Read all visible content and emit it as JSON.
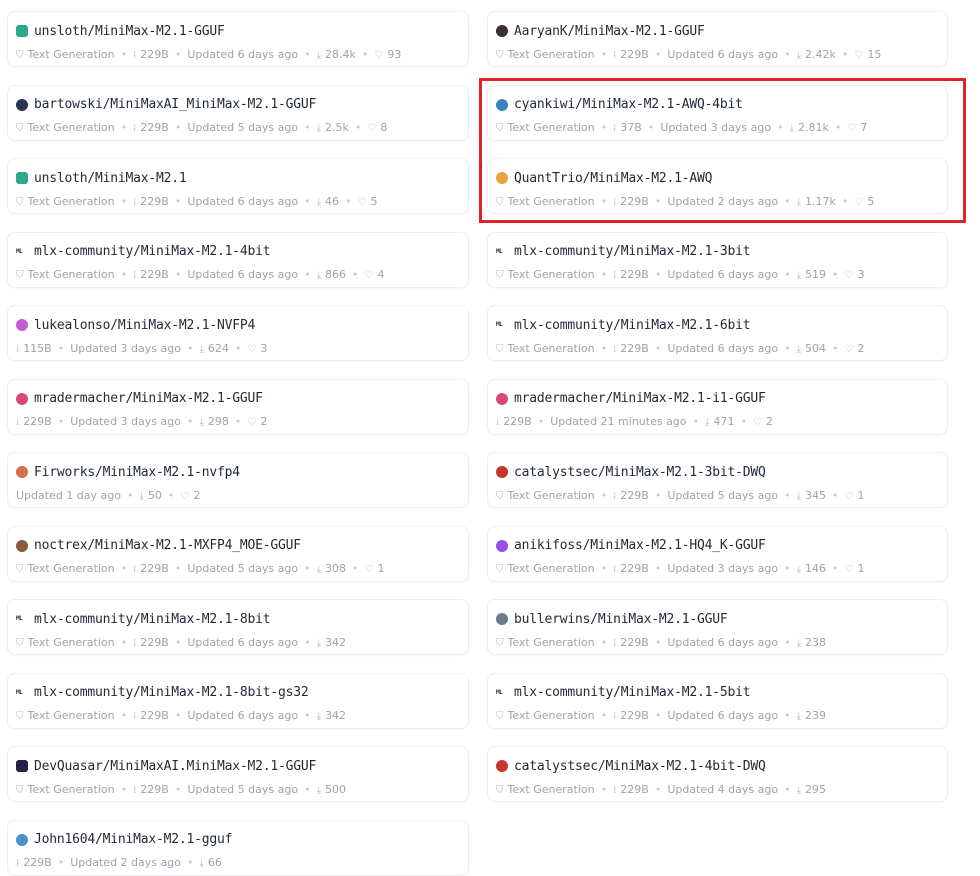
{
  "models": [
    {
      "avatar_color": "#2ea88a",
      "avatar_shape": "sq",
      "name": "unsloth/MiniMax-M2.1-GGUF",
      "task": "Text Generation",
      "size": "229B",
      "updated": "Updated 6 days ago",
      "downloads": "28.4k",
      "likes": "93"
    },
    {
      "avatar_color": "#3a2f2a",
      "avatar_shape": "circle",
      "name": "AaryanK/MiniMax-M2.1-GGUF",
      "task": "Text Generation",
      "size": "229B",
      "updated": "Updated 6 days ago",
      "downloads": "2.42k",
      "likes": "15"
    },
    {
      "avatar_color": "#2b3550",
      "avatar_shape": "circle",
      "name": "bartowski/MiniMaxAI_MiniMax-M2.1-GGUF",
      "task": "Text Generation",
      "size": "229B",
      "updated": "Updated 5 days ago",
      "downloads": "2.5k",
      "likes": "8"
    },
    {
      "avatar_color": "#3b82c4",
      "avatar_shape": "circle",
      "name": "cyankiwi/MiniMax-M2.1-AWQ-4bit",
      "task": "Text Generation",
      "size": "37B",
      "updated": "Updated 3 days ago",
      "downloads": "2.81k",
      "likes": "7"
    },
    {
      "avatar_color": "#2ea88a",
      "avatar_shape": "sq",
      "name": "unsloth/MiniMax-M2.1",
      "task": "Text Generation",
      "size": "229B",
      "updated": "Updated 6 days ago",
      "downloads": "46",
      "likes": "5"
    },
    {
      "avatar_color": "#e9a23b",
      "avatar_shape": "circle",
      "name": "QuantTrio/MiniMax-M2.1-AWQ",
      "task": "Text Generation",
      "size": "229B",
      "updated": "Updated 2 days ago",
      "downloads": "1.17k",
      "likes": "5"
    },
    {
      "avatar_label": "ML",
      "avatar_shape": "text",
      "name": "mlx-community/MiniMax-M2.1-4bit",
      "task": "Text Generation",
      "size": "229B",
      "updated": "Updated 6 days ago",
      "downloads": "866",
      "likes": "4"
    },
    {
      "avatar_label": "ML",
      "avatar_shape": "text",
      "name": "mlx-community/MiniMax-M2.1-3bit",
      "task": "Text Generation",
      "size": "229B",
      "updated": "Updated 6 days ago",
      "downloads": "519",
      "likes": "3"
    },
    {
      "avatar_color": "#c75ad6",
      "avatar_shape": "circle",
      "name": "lukealonso/MiniMax-M2.1-NVFP4",
      "size": "115B",
      "updated": "Updated 3 days ago",
      "downloads": "624",
      "likes": "3"
    },
    {
      "avatar_label": "ML",
      "avatar_shape": "text",
      "name": "mlx-community/MiniMax-M2.1-6bit",
      "task": "Text Generation",
      "size": "229B",
      "updated": "Updated 6 days ago",
      "downloads": "504",
      "likes": "2"
    },
    {
      "avatar_color": "#d9487a",
      "avatar_shape": "circle",
      "name": "mradermacher/MiniMax-M2.1-GGUF",
      "size": "229B",
      "updated": "Updated 3 days ago",
      "downloads": "298",
      "likes": "2"
    },
    {
      "avatar_color": "#d9487a",
      "avatar_shape": "circle",
      "name": "mradermacher/MiniMax-M2.1-i1-GGUF",
      "size": "229B",
      "updated": "Updated 21 minutes ago",
      "downloads": "471",
      "likes": "2"
    },
    {
      "avatar_color": "#d9704a",
      "avatar_shape": "circle",
      "name": "Firworks/MiniMax-M2.1-nvfp4",
      "updated": "Updated 1 day ago",
      "downloads": "50",
      "likes": "2"
    },
    {
      "avatar_color": "#c8352f",
      "avatar_shape": "circle",
      "name": "catalystsec/MiniMax-M2.1-3bit-DWQ",
      "task": "Text Generation",
      "size": "229B",
      "updated": "Updated 5 days ago",
      "downloads": "345",
      "likes": "1"
    },
    {
      "avatar_color": "#8a5a3a",
      "avatar_shape": "circle",
      "name": "noctrex/MiniMax-M2.1-MXFP4_MOE-GGUF",
      "task": "Text Generation",
      "size": "229B",
      "updated": "Updated 5 days ago",
      "downloads": "308",
      "likes": "1"
    },
    {
      "avatar_color": "#9b4dea",
      "avatar_shape": "circle",
      "name": "anikifoss/MiniMax-M2.1-HQ4_K-GGUF",
      "task": "Text Generation",
      "size": "229B",
      "updated": "Updated 3 days ago",
      "downloads": "146",
      "likes": "1"
    },
    {
      "avatar_label": "ML",
      "avatar_shape": "text",
      "name": "mlx-community/MiniMax-M2.1-8bit",
      "task": "Text Generation",
      "size": "229B",
      "updated": "Updated 6 days ago",
      "downloads": "342"
    },
    {
      "avatar_color": "#6b7d8c",
      "avatar_shape": "circle",
      "name": "bullerwins/MiniMax-M2.1-GGUF",
      "task": "Text Generation",
      "size": "229B",
      "updated": "Updated 6 days ago",
      "downloads": "238"
    },
    {
      "avatar_label": "ML",
      "avatar_shape": "text",
      "name": "mlx-community/MiniMax-M2.1-8bit-gs32",
      "task": "Text Generation",
      "size": "229B",
      "updated": "Updated 6 days ago",
      "downloads": "342"
    },
    {
      "avatar_label": "ML",
      "avatar_shape": "text",
      "name": "mlx-community/MiniMax-M2.1-5bit",
      "task": "Text Generation",
      "size": "229B",
      "updated": "Updated 6 days ago",
      "downloads": "239"
    },
    {
      "avatar_color": "#2a1f4a",
      "avatar_shape": "sq",
      "name": "DevQuasar/MiniMaxAI.MiniMax-M2.1-GGUF",
      "task": "Text Generation",
      "size": "229B",
      "updated": "Updated 5 days ago",
      "downloads": "500"
    },
    {
      "avatar_color": "#c8352f",
      "avatar_shape": "circle",
      "name": "catalystsec/MiniMax-M2.1-4bit-DWQ",
      "task": "Text Generation",
      "size": "229B",
      "updated": "Updated 4 days ago",
      "downloads": "295"
    },
    {
      "avatar_color": "#4a8fd6",
      "avatar_shape": "circle",
      "name": "John1604/MiniMax-M2.1-gguf",
      "size": "229B",
      "updated": "Updated 2 days ago",
      "downloads": "66"
    }
  ],
  "highlight": {
    "color": "#dc2328"
  },
  "icons": {
    "task": "tag-icon",
    "size": "parameters-icon",
    "downloads": "download-icon",
    "likes": "heart-icon"
  }
}
